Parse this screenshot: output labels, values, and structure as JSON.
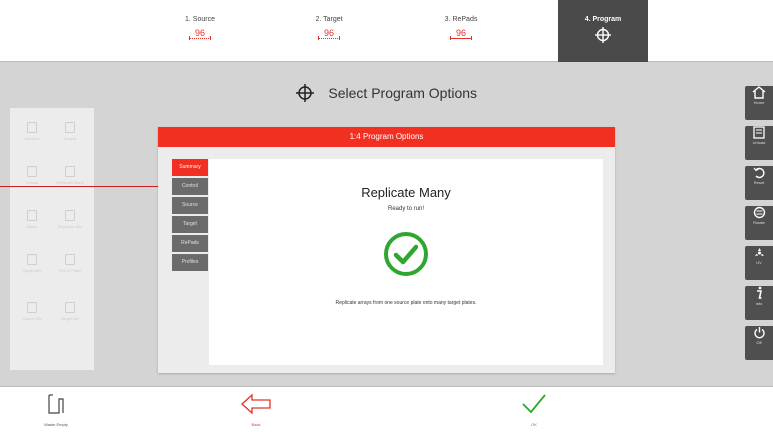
{
  "steps": [
    {
      "label": "1. Source",
      "value": "96"
    },
    {
      "label": "2. Target",
      "value": "96"
    },
    {
      "label": "3. RePads",
      "value": "96"
    },
    {
      "label": "4. Program"
    }
  ],
  "page": {
    "title": "Select Program Options"
  },
  "dialog": {
    "header": "1:4 Program Options",
    "tabs": [
      "Summary",
      "Control",
      "Source",
      "Target",
      "RePads",
      "Profiles"
    ],
    "heading": "Replicate Many",
    "status": "Ready to run!",
    "description": "Replicate arrays from one source plate onto many target plates."
  },
  "sidebar": {
    "items": [
      {
        "label": "Home",
        "icon": "home-icon"
      },
      {
        "label": "Unload",
        "icon": "unload-icon"
      },
      {
        "label": "Reset",
        "icon": "reset-icon"
      },
      {
        "label": "Rotate",
        "icon": "rotate-icon"
      },
      {
        "label": "UV",
        "icon": "uv-icon"
      },
      {
        "label": "Info",
        "icon": "info-icon"
      },
      {
        "label": "Off",
        "icon": "power-icon"
      }
    ]
  },
  "palette": {
    "items": [
      "Recents",
      "Repeat",
      "Unload",
      "Replicate Many",
      "Mixes",
      "Replicate Mix",
      "Target Mix",
      "Pick & Place",
      "Source Mix",
      "Target Mix"
    ]
  },
  "bottom": {
    "waste_label": "Waste Empty",
    "back_label": "Back",
    "ok_label": "OK"
  },
  "colors": {
    "accent": "#f23022",
    "ok": "#2fa62f",
    "dark": "#4a4a4a"
  }
}
